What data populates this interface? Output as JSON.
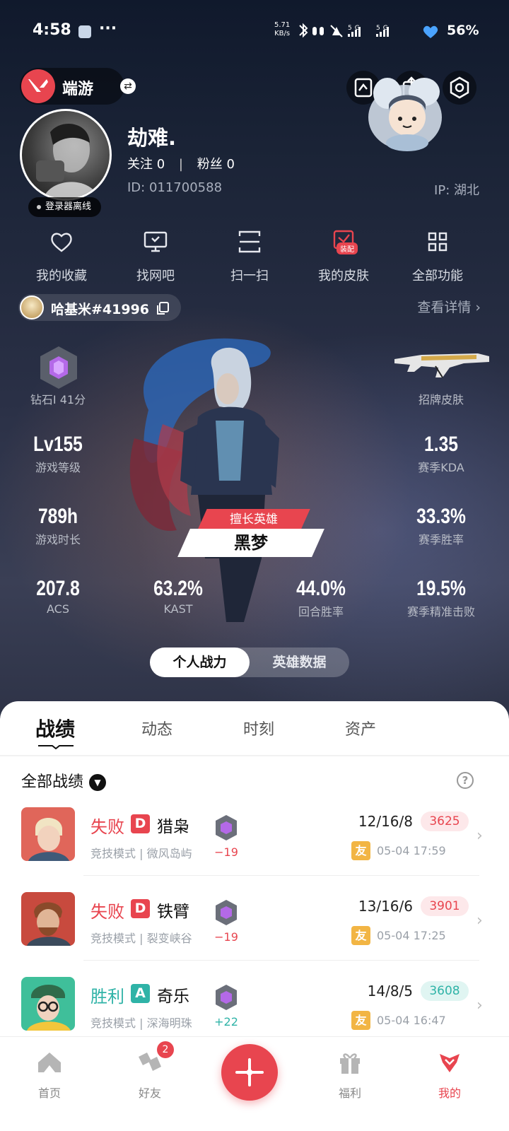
{
  "status_bar": {
    "time": "4:58",
    "more": "···",
    "net_speed_value": "5.71",
    "net_speed_unit": "KB/s",
    "battery": "56%"
  },
  "header": {
    "game_name": "端游"
  },
  "profile": {
    "nickname": "劫难.",
    "follow_label": "关注",
    "follow_count": "0",
    "fans_label": "粉丝",
    "fans_count": "0",
    "id_text": "ID: 011700588",
    "ip_text": "IP: 湖北",
    "offline_text": "登录器离线"
  },
  "quick_actions": [
    {
      "label": "我的收藏",
      "icon": "heart-icon"
    },
    {
      "label": "找网吧",
      "icon": "monitor-icon"
    },
    {
      "label": "扫一扫",
      "icon": "scan-icon"
    },
    {
      "label": "我的皮肤",
      "icon": "skin-icon",
      "badge": "装配"
    },
    {
      "label": "全部功能",
      "icon": "grid-icon"
    }
  ],
  "player": {
    "tag": "哈基米#41996",
    "detail_link": "查看详情 ›"
  },
  "stats": {
    "rank": "钻石I 41分",
    "skin_label": "招牌皮肤",
    "level_value": "Lv155",
    "level_label": "游戏等级",
    "kda_value": "1.35",
    "kda_label": "赛季KDA",
    "hours_value": "789h",
    "hours_label": "游戏时长",
    "winrate_value": "33.3%",
    "winrate_label": "赛季胜率",
    "acs_value": "207.8",
    "acs_label": "ACS",
    "kast_value": "63.2%",
    "kast_label": "KAST",
    "round_win_value": "44.0%",
    "round_win_label": "回合胜率",
    "hs_value": "19.5%",
    "hs_label": "赛季精准击败",
    "best_hero_tag": "擅长英雄",
    "best_hero_name": "黑梦"
  },
  "segments": {
    "active": "个人战力",
    "inactive": "英雄数据"
  },
  "tabs": [
    "战绩",
    "动态",
    "时刻",
    "资产"
  ],
  "filter": {
    "label": "全部战绩"
  },
  "matches": [
    {
      "result": "失败",
      "grade": "D",
      "agent": "猎枭",
      "mode": "竞技模式 | 微风岛屿",
      "rr": "−19",
      "kda": "12/16/8",
      "score": "3625",
      "friend": "友",
      "time": "05-04 17:59"
    },
    {
      "result": "失败",
      "grade": "D",
      "agent": "铁臂",
      "mode": "竞技模式 | 裂变峡谷",
      "rr": "−19",
      "kda": "13/16/6",
      "score": "3901",
      "friend": "友",
      "time": "05-04 17:25"
    },
    {
      "result": "胜利",
      "grade": "A",
      "agent": "奇乐",
      "mode": "竞技模式 | 深海明珠",
      "rr": "+22",
      "kda": "14/8/5",
      "score": "3608",
      "friend": "友",
      "time": "05-04 16:47"
    }
  ],
  "bottom_nav": {
    "home": "首页",
    "friends": "好友",
    "friends_badge": "2",
    "welfare": "福利",
    "mine": "我的"
  },
  "colors": {
    "accent": "#e8454f",
    "win": "#2fb3a7",
    "friend_tag": "#f2b544"
  }
}
